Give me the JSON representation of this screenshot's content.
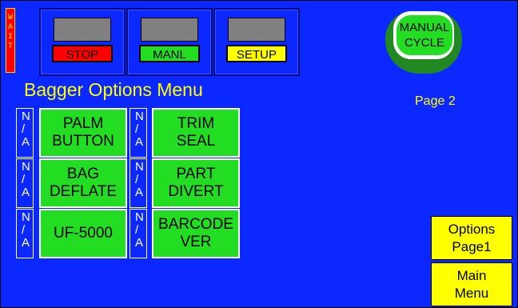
{
  "wait_indicator": "WAIT",
  "status_buttons": [
    {
      "label": "STOP",
      "color": "#ff0000"
    },
    {
      "label": "MANL",
      "color": "#22dd22"
    },
    {
      "label": "SETUP",
      "color": "#ffff00"
    }
  ],
  "menu_title": "Bagger Options Menu",
  "na_label": "N\n/\nA",
  "options": [
    {
      "label": "PALM\nBUTTON"
    },
    {
      "label": "TRIM\nSEAL"
    },
    {
      "label": "BAG\nDEFLATE"
    },
    {
      "label": "PART\nDIVERT"
    },
    {
      "label": "UF-5000"
    },
    {
      "label": "BARCODE\nVER"
    }
  ],
  "manual_cycle": "MANUAL\nCYCLE",
  "page_label": "Page 2",
  "nav": {
    "options_page1": "Options\nPage1",
    "main_menu": "Main\nMenu"
  },
  "colors": {
    "background": "#0a28ff",
    "button_green": "#22dd22",
    "text_yellow": "#ffff00"
  }
}
